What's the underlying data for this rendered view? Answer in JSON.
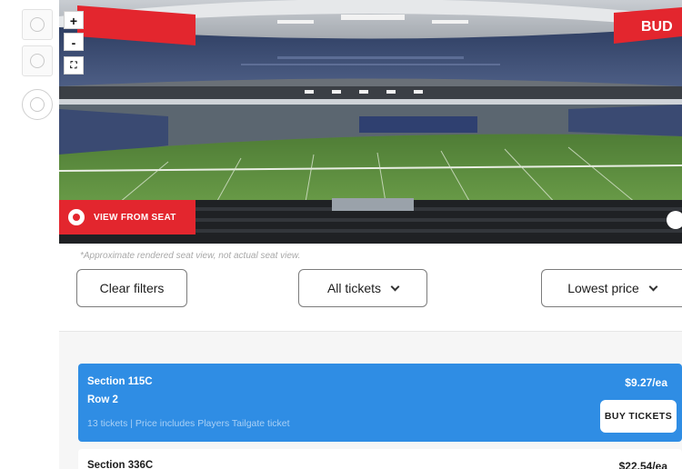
{
  "seat_view": {
    "badge_label": "VIEW FROM SEAT",
    "zoom_in_label": "+",
    "zoom_out_label": "-",
    "disclaimer": "*Approximate rendered seat view, not actual seat view.",
    "scoreboard_text": "BUD"
  },
  "filters": {
    "clear_label": "Clear filters",
    "ticket_filter_selected": "All tickets",
    "sort_selected": "Lowest price"
  },
  "listings": [
    {
      "section": "Section 115C",
      "row": "Row 2",
      "description": "13 tickets | Price includes Players Tailgate ticket",
      "price": "$9.27/ea",
      "buy_label": "BUY TICKETS",
      "selected": true
    },
    {
      "section": "Section 336C",
      "price": "$22.54/ea",
      "selected": false
    }
  ],
  "colors": {
    "accent_red": "#e3262e",
    "selected_card_blue": "#2f8de4",
    "field_green": "#5a8f3e"
  },
  "icons": {
    "rail_top": "zoom-in-circle-icon",
    "rail_middle": "zoom-out-circle-icon",
    "rail_bottom": "search-circle-icon",
    "fullscreen": "fullscreen-icon",
    "view_badge": "target-icon"
  }
}
